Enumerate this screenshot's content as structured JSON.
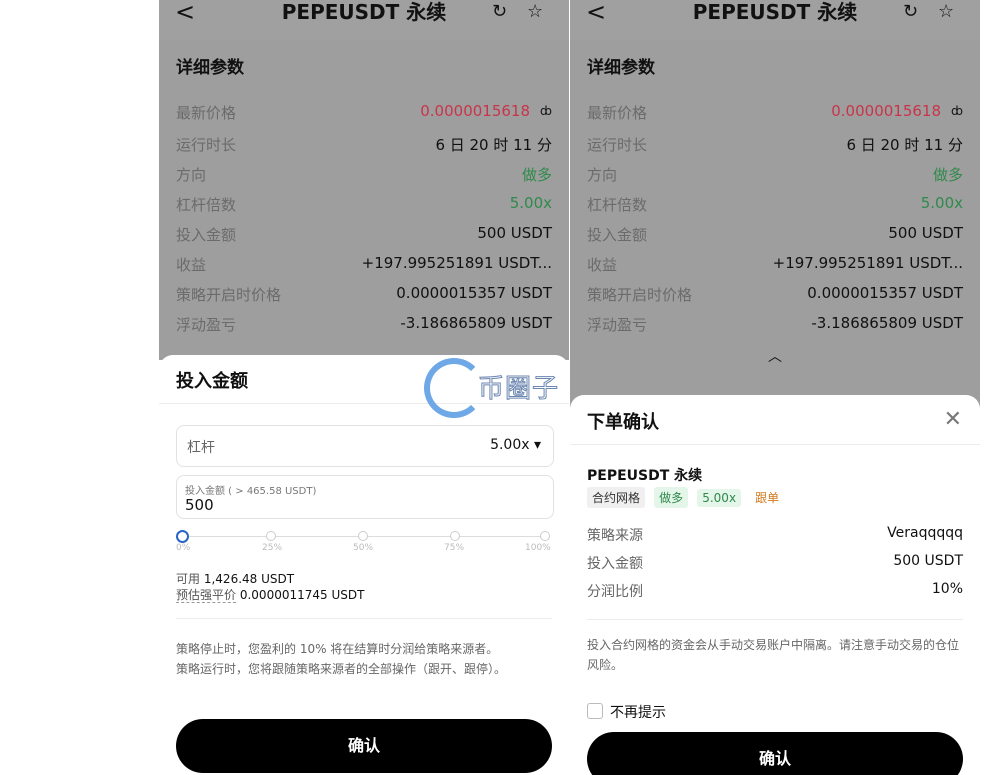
{
  "header": {
    "back": "<",
    "title": "PEPEUSDT 永续",
    "refresh_icon": "refresh-icon",
    "star_icon": "star-icon"
  },
  "details": {
    "section_title": "详细参数",
    "rows": [
      {
        "key": "最新价格",
        "value": "0.0000015618"
      },
      {
        "key": "运行时长",
        "value": "6 日 20 时 11 分"
      },
      {
        "key": "方向",
        "value": "做多"
      },
      {
        "key": "杠杆倍数",
        "value": "5.00x"
      },
      {
        "key": "投入金额",
        "value": "500 USDT"
      },
      {
        "key": "收益",
        "value": "+197.995251891 USDT..."
      },
      {
        "key": "策略开启时价格",
        "value": "0.0000015357 USDT"
      },
      {
        "key": "浮动盈亏",
        "value": "-3.186865809 USDT"
      }
    ],
    "colors": {
      "price_red": "#c9344a",
      "green": "#2f8a4b"
    }
  },
  "left_sheet": {
    "title": "投入金额",
    "leverage_label": "杠杆",
    "leverage_value": "5.00x ▾",
    "amount_label": "投入金额 ( > 465.58 USDT)",
    "amount_value": "500",
    "slider_value": 0,
    "slider_ticks": [
      "0%",
      "25%",
      "50%",
      "75%",
      "100%"
    ],
    "available_label": "可用",
    "available_value": "1,426.48 USDT",
    "liq_label": "预估强平价",
    "liq_value": "0.0000011745 USDT",
    "note_1": "策略停止时，您盈利的 10% 将在结算时分润给策略来源者。",
    "note_2": "策略运行时，您将跟随策略来源者的全部操作（跟开、跟停）。",
    "confirm": "确认"
  },
  "right_sheet": {
    "title": "下单确认",
    "pair": "PEPEUSDT 永续",
    "tags": [
      "合约网格",
      "做多",
      "5.00x",
      "跟单"
    ],
    "rows": [
      {
        "key": "策略来源",
        "value": "Veraqqqqq"
      },
      {
        "key": "投入金额",
        "value": "500 USDT"
      },
      {
        "key": "分润比例",
        "value": "10%"
      }
    ],
    "note": "投入合约网格的资金会从手动交易账户中隔离。请注意手动交易的仓位风险。",
    "dont_remind": "不再提示",
    "confirm": "确认"
  },
  "watermark": {
    "text": "币圈子"
  }
}
